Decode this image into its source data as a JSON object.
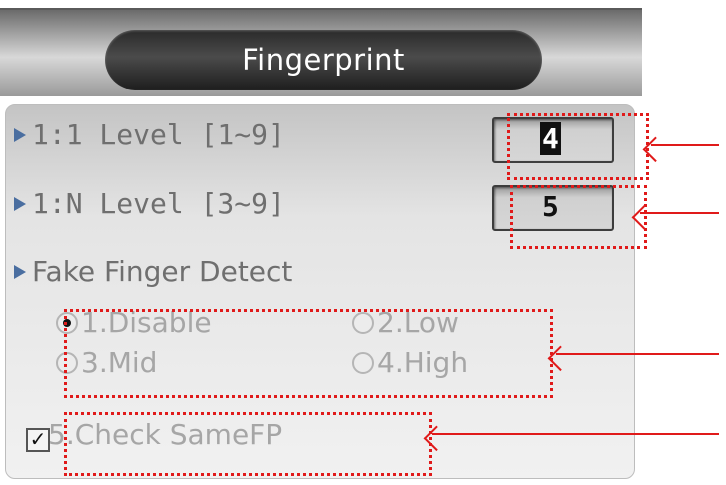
{
  "header": {
    "title": "Fingerprint"
  },
  "settings": {
    "level_1to1": {
      "label": "1:1 Level [1~9]",
      "value": "4"
    },
    "level_1toN": {
      "label": "1:N Level [3~9]",
      "value": "5"
    },
    "fake_finger": {
      "label": "Fake Finger Detect",
      "options": [
        "1.Disable",
        "2.Low",
        "3.Mid",
        "4.High"
      ],
      "selected": "1.Disable"
    },
    "check_same_fp": {
      "label": "5.Check SameFP",
      "checked": true,
      "check_mark": "✓"
    }
  },
  "colors": {
    "annotation": "#e01a1a",
    "title_bg": "#2a2a2a",
    "label": "#6f6f6f",
    "disabled": "#a6a6a6"
  }
}
